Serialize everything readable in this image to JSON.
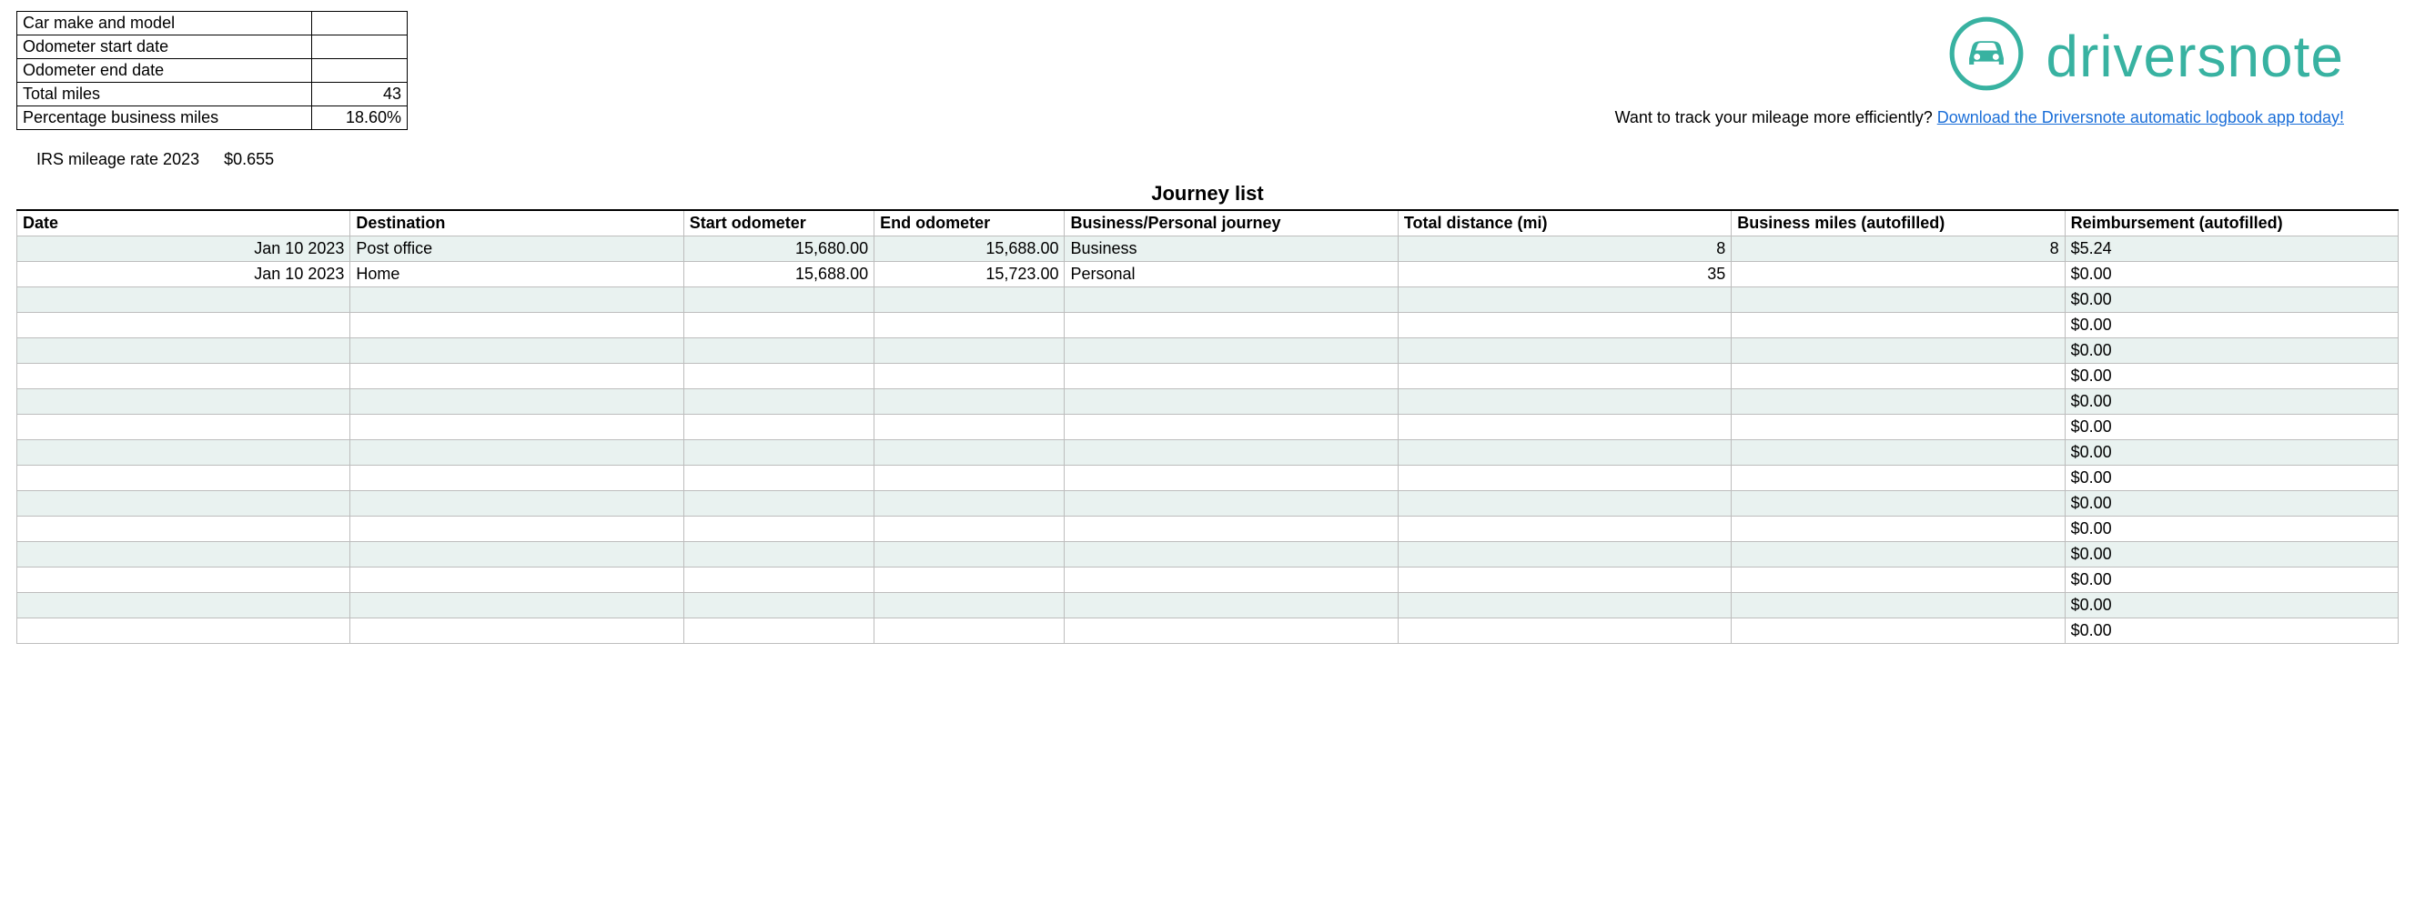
{
  "summary": {
    "rows": [
      {
        "label": "Car make and model",
        "value": ""
      },
      {
        "label": "Odometer start date",
        "value": ""
      },
      {
        "label": "Odometer end date",
        "value": ""
      },
      {
        "label": "Total miles",
        "value": "43"
      },
      {
        "label": "Percentage business miles",
        "value": "18.60%"
      }
    ]
  },
  "irs": {
    "label": "IRS mileage rate 2023",
    "rate": "$0.655"
  },
  "logo": {
    "text": "driversnote"
  },
  "tagline": {
    "prefix": "Want to track your mileage more efficiently? ",
    "link_text": "Download the Driversnote automatic logbook app today!"
  },
  "journey": {
    "title": "Journey list",
    "headers": [
      "Date",
      "Destination",
      "Start odometer",
      "End odometer",
      "Business/Personal journey",
      "Total distance (mi)",
      "Business miles (autofilled)",
      "Reimbursement (autofilled)"
    ],
    "rows": [
      {
        "date": "Jan 10 2023",
        "dest": "Post office",
        "start": "15,680.00",
        "end": "15,688.00",
        "type": "Business",
        "dist": "8",
        "biz": "8",
        "reimb": "$5.24"
      },
      {
        "date": "Jan 10 2023",
        "dest": "Home",
        "start": "15,688.00",
        "end": "15,723.00",
        "type": "Personal",
        "dist": "35",
        "biz": "",
        "reimb": "$0.00"
      },
      {
        "date": "",
        "dest": "",
        "start": "",
        "end": "",
        "type": "",
        "dist": "",
        "biz": "",
        "reimb": "$0.00"
      },
      {
        "date": "",
        "dest": "",
        "start": "",
        "end": "",
        "type": "",
        "dist": "",
        "biz": "",
        "reimb": "$0.00"
      },
      {
        "date": "",
        "dest": "",
        "start": "",
        "end": "",
        "type": "",
        "dist": "",
        "biz": "",
        "reimb": "$0.00"
      },
      {
        "date": "",
        "dest": "",
        "start": "",
        "end": "",
        "type": "",
        "dist": "",
        "biz": "",
        "reimb": "$0.00"
      },
      {
        "date": "",
        "dest": "",
        "start": "",
        "end": "",
        "type": "",
        "dist": "",
        "biz": "",
        "reimb": "$0.00"
      },
      {
        "date": "",
        "dest": "",
        "start": "",
        "end": "",
        "type": "",
        "dist": "",
        "biz": "",
        "reimb": "$0.00"
      },
      {
        "date": "",
        "dest": "",
        "start": "",
        "end": "",
        "type": "",
        "dist": "",
        "biz": "",
        "reimb": "$0.00"
      },
      {
        "date": "",
        "dest": "",
        "start": "",
        "end": "",
        "type": "",
        "dist": "",
        "biz": "",
        "reimb": "$0.00"
      },
      {
        "date": "",
        "dest": "",
        "start": "",
        "end": "",
        "type": "",
        "dist": "",
        "biz": "",
        "reimb": "$0.00"
      },
      {
        "date": "",
        "dest": "",
        "start": "",
        "end": "",
        "type": "",
        "dist": "",
        "biz": "",
        "reimb": "$0.00"
      },
      {
        "date": "",
        "dest": "",
        "start": "",
        "end": "",
        "type": "",
        "dist": "",
        "biz": "",
        "reimb": "$0.00"
      },
      {
        "date": "",
        "dest": "",
        "start": "",
        "end": "",
        "type": "",
        "dist": "",
        "biz": "",
        "reimb": "$0.00"
      },
      {
        "date": "",
        "dest": "",
        "start": "",
        "end": "",
        "type": "",
        "dist": "",
        "biz": "",
        "reimb": "$0.00"
      },
      {
        "date": "",
        "dest": "",
        "start": "",
        "end": "",
        "type": "",
        "dist": "",
        "biz": "",
        "reimb": "$0.00"
      }
    ]
  }
}
